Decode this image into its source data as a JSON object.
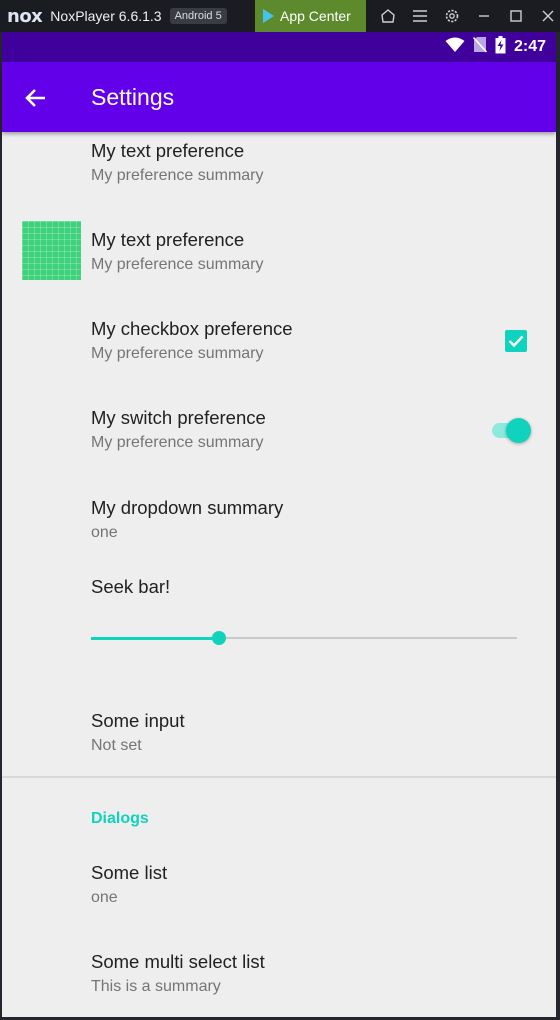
{
  "emulator": {
    "logo": "nox",
    "title": "NoxPlayer 6.6.1.3",
    "android_badge": "Android 5",
    "app_center_label": "App Center",
    "icons": [
      "home-icon",
      "menu-icon",
      "gear-icon",
      "minimize-icon",
      "maximize-icon",
      "close-icon"
    ]
  },
  "status_bar": {
    "time": "2:47",
    "icons": [
      "wifi-icon",
      "no-sim-icon",
      "battery-charging-icon"
    ]
  },
  "toolbar": {
    "title": "Settings"
  },
  "preferences": {
    "text_pref_1": {
      "title": "My text preference",
      "summary": "My preference summary"
    },
    "text_pref_2": {
      "title": "My text preference",
      "summary": "My preference summary"
    },
    "checkbox_pref": {
      "title": "My checkbox preference",
      "summary": "My preference summary",
      "checked": true
    },
    "switch_pref": {
      "title": "My switch preference",
      "summary": "My preference summary",
      "on": true
    },
    "dropdown_pref": {
      "title": "My dropdown summary",
      "summary": "one"
    },
    "seekbar_pref": {
      "title": "Seek bar!",
      "value_fraction": 0.3
    },
    "input_pref": {
      "title": "Some input",
      "summary": "Not set"
    }
  },
  "dialogs_category": {
    "label": "Dialogs",
    "list_pref": {
      "title": "Some list",
      "summary": "one"
    },
    "multi_list_pref": {
      "title": "Some multi select list",
      "summary": "This is a summary"
    }
  },
  "colors": {
    "toolbar": "#6200ea",
    "status_bar": "#3f009c",
    "accent": "#0fd3bd",
    "background": "#eeeeee"
  }
}
